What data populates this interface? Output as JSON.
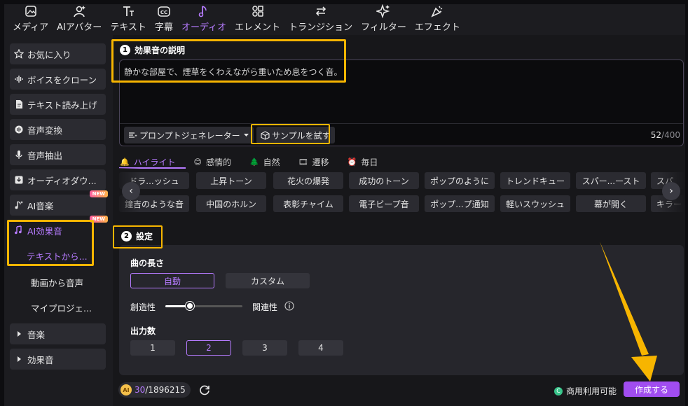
{
  "toolbar": {
    "items": [
      {
        "label": "メディア",
        "icon": "media-icon"
      },
      {
        "label": "AIアバター",
        "icon": "avatar-icon"
      },
      {
        "label": "テキスト",
        "icon": "text-icon"
      },
      {
        "label": "字幕",
        "icon": "subtitle-icon"
      },
      {
        "label": "オーディオ",
        "icon": "audio-icon",
        "active": true
      },
      {
        "label": "エレメント",
        "icon": "element-icon"
      },
      {
        "label": "トランジション",
        "icon": "transition-icon"
      },
      {
        "label": "フィルター",
        "icon": "filter-icon"
      },
      {
        "label": "エフェクト",
        "icon": "effect-icon"
      }
    ]
  },
  "sidebar": {
    "items": [
      {
        "label": "お気に入り",
        "icon": "star-icon"
      },
      {
        "label": "ボイスをクローン",
        "icon": "waveform-icon"
      },
      {
        "label": "テキスト読み上げ",
        "icon": "document-icon"
      },
      {
        "label": "音声変換",
        "icon": "voice-convert-icon"
      },
      {
        "label": "音声抽出",
        "icon": "microphone-icon"
      },
      {
        "label": "オーディオダウ...",
        "icon": "download-icon"
      },
      {
        "label": "AI音楽",
        "icon": "music-note-icon",
        "badge": "NEW"
      },
      {
        "label": "AI効果音",
        "icon": "sfx-icon",
        "badge": "NEW"
      },
      {
        "label": "テキストから..."
      },
      {
        "label": "動画から音声"
      },
      {
        "label": "マイプロジェ..."
      },
      {
        "label": "音楽",
        "icon": "caret-right-icon"
      },
      {
        "label": "効果音",
        "icon": "caret-right-icon"
      }
    ]
  },
  "description": {
    "step": "1",
    "title": "効果音の説明",
    "text": "静かな部屋で、煙草をくわえながら重いため息をつく音。",
    "prompt_generator": "プロンプトジェネレーター",
    "sample_button": "サンプルを試す",
    "count": "52",
    "max": "/400"
  },
  "tabs": [
    {
      "label": "ハイライト",
      "icon": "🔔"
    },
    {
      "label": "感情的",
      "icon": "😊"
    },
    {
      "label": "自然",
      "icon": "🌲"
    },
    {
      "label": "遷移",
      "icon": "🎞"
    },
    {
      "label": "毎日",
      "icon": "⏰"
    }
  ],
  "chips_row1": [
    "ドラ...ッシュ",
    "上昇トーン",
    "花火の爆発",
    "成功のトーン",
    "ポップのように",
    "トレンドキュー",
    "スパー...ースト",
    "スパ"
  ],
  "chips_row2": [
    "鐘吉のような音",
    "中国のホルン",
    "表彰チャイム",
    "電子ビープ音",
    "ポップ...プ通知",
    "軽いスウッシュ",
    "幕が開く",
    "キラー"
  ],
  "settings": {
    "step": "2",
    "title": "設定",
    "length_label": "曲の長さ",
    "length_auto": "自動",
    "length_custom": "カスタム",
    "creativity": "創造性",
    "relevance": "関連性",
    "slider_value": 0.32,
    "output_label": "出力数",
    "outputs": [
      "1",
      "2",
      "3",
      "4"
    ],
    "selected_output": "2"
  },
  "footer": {
    "credits_used": "30",
    "credits_total": "/1896215",
    "coin_label": "AI",
    "commercial": "商用利用可能",
    "commercial_icon": "C",
    "create_button": "作成する"
  },
  "colors": {
    "accent": "#b67bff",
    "highlight": "#f7b500",
    "create": "#a14df0"
  }
}
